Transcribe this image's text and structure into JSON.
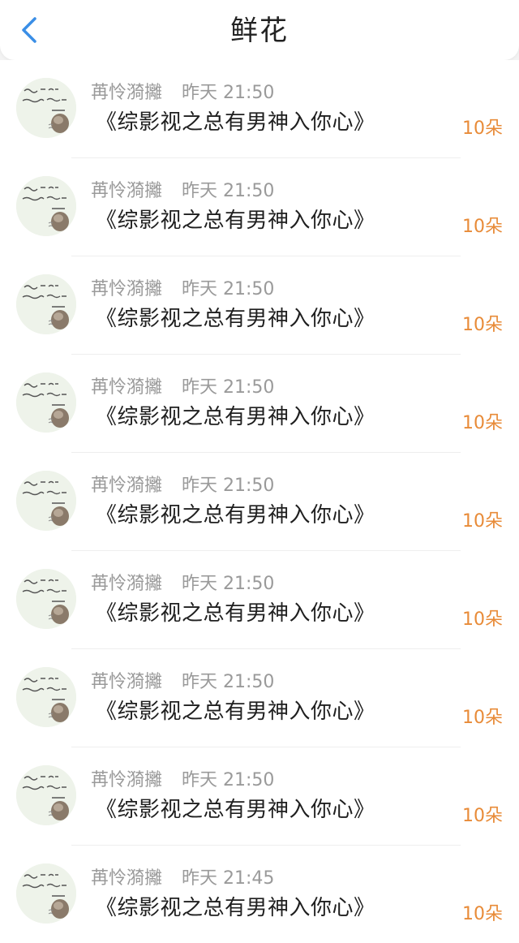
{
  "header": {
    "title": "鲜花",
    "back_icon": "chevron-left-icon",
    "accent_color": "#3a8ee6"
  },
  "records": [
    {
      "user": "苒怜漪攡",
      "time": "昨天 21:50",
      "book": "《综影视之总有男神入你心》",
      "amount": "10朵"
    },
    {
      "user": "苒怜漪攡",
      "time": "昨天 21:50",
      "book": "《综影视之总有男神入你心》",
      "amount": "10朵"
    },
    {
      "user": "苒怜漪攡",
      "time": "昨天 21:50",
      "book": "《综影视之总有男神入你心》",
      "amount": "10朵"
    },
    {
      "user": "苒怜漪攡",
      "time": "昨天 21:50",
      "book": "《综影视之总有男神入你心》",
      "amount": "10朵"
    },
    {
      "user": "苒怜漪攡",
      "time": "昨天 21:50",
      "book": "《综影视之总有男神入你心》",
      "amount": "10朵"
    },
    {
      "user": "苒怜漪攡",
      "time": "昨天 21:50",
      "book": "《综影视之总有男神入你心》",
      "amount": "10朵"
    },
    {
      "user": "苒怜漪攡",
      "time": "昨天 21:50",
      "book": "《综影视之总有男神入你心》",
      "amount": "10朵"
    },
    {
      "user": "苒怜漪攡",
      "time": "昨天 21:50",
      "book": "《综影视之总有男神入你心》",
      "amount": "10朵"
    },
    {
      "user": "苒怜漪攡",
      "time": "昨天 21:45",
      "book": "《综影视之总有男神入你心》",
      "amount": "10朵"
    }
  ],
  "colors": {
    "amount": "#e88b38",
    "meta_text": "#9a9a9a",
    "primary_text": "#1f1f1f"
  }
}
